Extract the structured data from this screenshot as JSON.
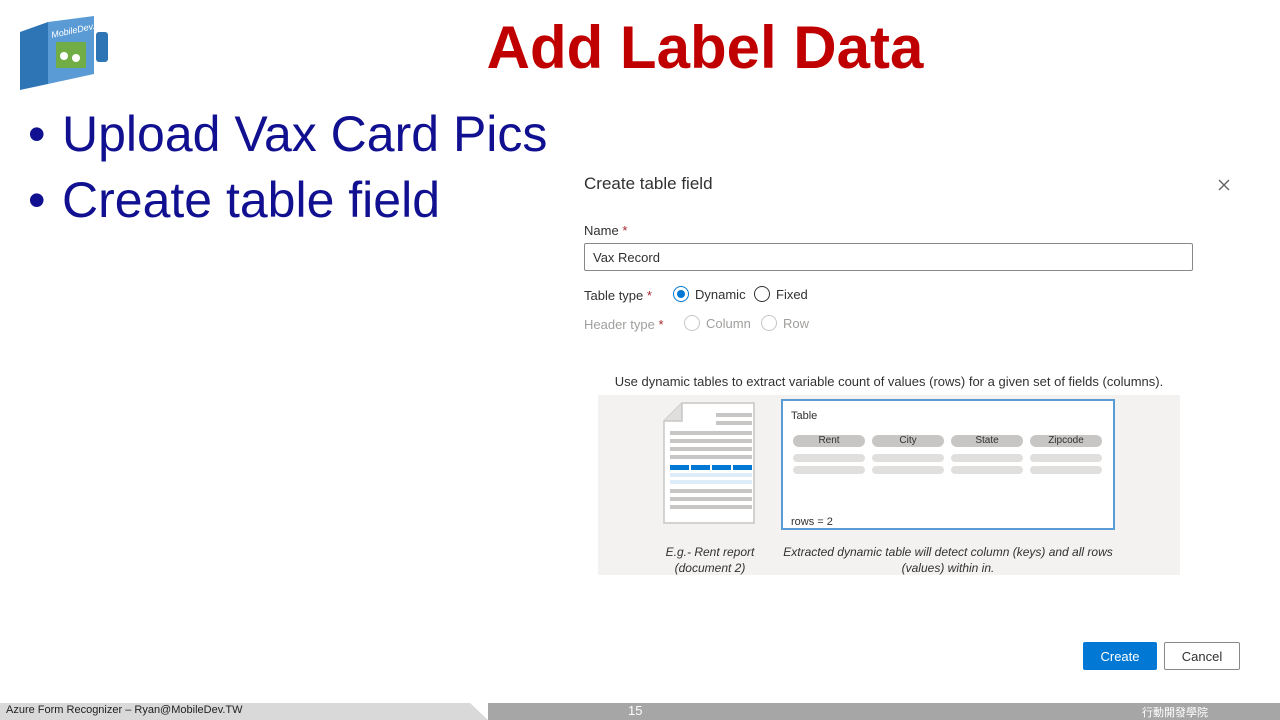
{
  "slide": {
    "title": "Add Label Data",
    "bullets": [
      "Upload Vax Card Pics",
      "Create table field"
    ],
    "logo_text": "MobileDev.TW"
  },
  "dialog": {
    "title": "Create table field",
    "close_icon": "close-icon",
    "name_label": "Name",
    "required_mark": "*",
    "name_value": "Vax Record",
    "table_type_label": "Table type",
    "table_type_options": [
      "Dynamic",
      "Fixed"
    ],
    "table_type_selected": "Dynamic",
    "header_type_label": "Header type",
    "header_type_options": [
      "Column",
      "Row"
    ],
    "help_text": "Use dynamic tables to extract variable count of values (rows) for a given set of fields (columns).",
    "illustration": {
      "doc_caption_line1": "E.g.- Rent report",
      "doc_caption_line2": "(document 2)",
      "table_title": "Table",
      "columns": [
        "Rent",
        "City",
        "State",
        "Zipcode"
      ],
      "rows_text": "rows = 2",
      "card_caption_line1": "Extracted dynamic table will detect column (keys) and all rows",
      "card_caption_line2": "(values) within in."
    },
    "create_label": "Create",
    "cancel_label": "Cancel"
  },
  "footer": {
    "left_text": "Azure Form Recognizer – Ryan@MobileDev.TW",
    "page_number": "15",
    "right_text": "行動開發學院"
  },
  "colors": {
    "title_red": "#c00000",
    "bullet_blue": "#101090",
    "accent_blue": "#0078d4"
  }
}
